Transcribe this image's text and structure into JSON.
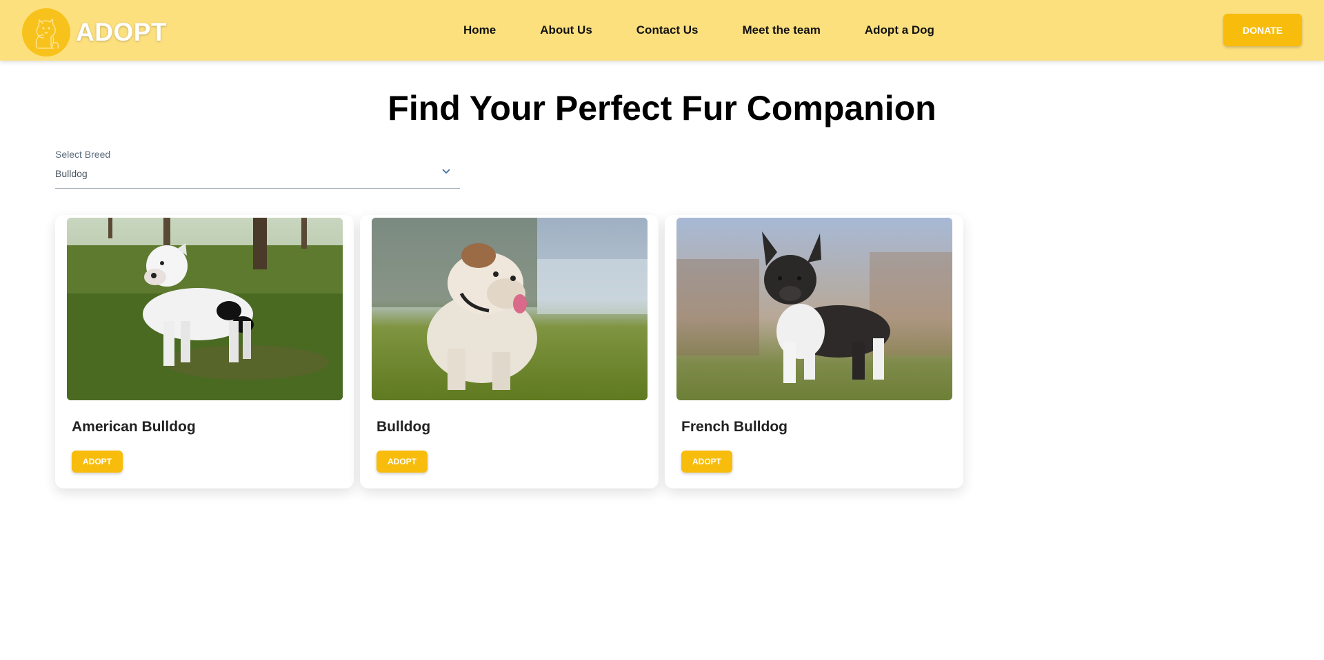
{
  "brand": {
    "name": "ADOPT",
    "logo_icon": "dog-cat-logo-icon",
    "accent": "#f8c21c"
  },
  "nav": {
    "background": "#fde07e",
    "links": [
      {
        "label": "Home"
      },
      {
        "label": "About Us"
      },
      {
        "label": "Contact Us"
      },
      {
        "label": "Meet the team"
      },
      {
        "label": "Adopt a Dog"
      }
    ],
    "donate_label": "DONATE"
  },
  "page": {
    "title": "Find Your Perfect Fur Companion"
  },
  "breed_select": {
    "label": "Select Breed",
    "value": "Bulldog",
    "chevron_icon": "chevron-down-icon"
  },
  "cards": [
    {
      "name": "American Bulldog",
      "image": "american-bulldog-photo",
      "button_label": "ADOPT"
    },
    {
      "name": "Bulldog",
      "image": "bulldog-photo",
      "button_label": "ADOPT"
    },
    {
      "name": "French Bulldog",
      "image": "french-bulldog-photo",
      "button_label": "ADOPT"
    }
  ],
  "colors": {
    "button": "#f8bc0c",
    "text": "#111111"
  }
}
